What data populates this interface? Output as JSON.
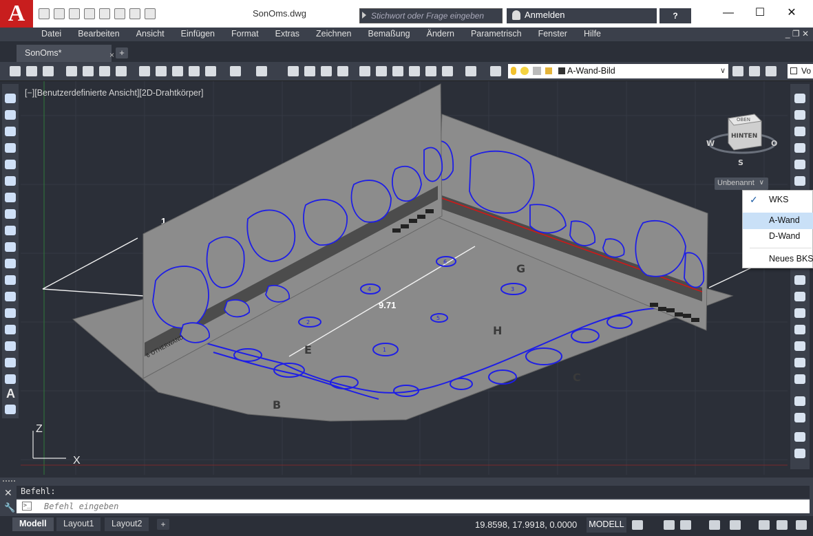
{
  "app": {
    "logo_text": "A",
    "document_title": "SonOms.dwg",
    "search_placeholder": "Stichwort oder Frage eingeben",
    "login_label": "Anmelden",
    "help_label": "?",
    "window_controls": [
      "minimize-icon",
      "maximize-icon",
      "close-icon"
    ],
    "accent_color": "#c81e1e"
  },
  "menu": [
    "Datei",
    "Bearbeiten",
    "Ansicht",
    "Einfügen",
    "Format",
    "Extras",
    "Zeichnen",
    "Bemaßung",
    "Ändern",
    "Parametrisch",
    "Fenster",
    "Hilfe"
  ],
  "tabs": {
    "file_tab": "SonOms*",
    "close_glyph": "×",
    "new_tab_glyph": "+"
  },
  "toolbar": {
    "layer_name": "A-Wand-Bild",
    "visual_style_fragment": "Vo"
  },
  "viewport": {
    "label": "[−][Benutzerdefinierte Ansicht][2D-Drahtkörper]",
    "dimension_text": "9.71",
    "dimension_left": "1",
    "area_letters": [
      "G",
      "H",
      "E",
      "B",
      "C"
    ],
    "stone_numbers": [
      "2",
      "4",
      "5",
      "6",
      "3",
      "1"
    ],
    "axis_z": "Z",
    "axis_x": "X",
    "plate_caption": "6 OTHERWAND"
  },
  "viewcube": {
    "face_label": "HINTEN",
    "top_label": "OBEN",
    "compass": {
      "west": "W",
      "east": "O",
      "south": "S"
    },
    "ucs_label": "Unbenannt"
  },
  "ucs_menu": {
    "items": [
      {
        "label": "WKS",
        "checked": true
      },
      {
        "label": "A-Wand",
        "selected": true
      },
      {
        "label": "D-Wand"
      },
      {
        "label": "Neues BKS"
      }
    ],
    "check_glyph": "✓"
  },
  "command": {
    "history": "Befehl:",
    "placeholder": "Befehl eingeben",
    "prompt_glyph": ">_"
  },
  "status": {
    "layout_tabs": [
      "Modell",
      "Layout1",
      "Layout2"
    ],
    "add_layout_glyph": "+",
    "coordinates": "19.8598, 17.9918, 0.0000",
    "space": "MODELL"
  },
  "colors": {
    "drawing_blue": "#1e1ee6",
    "panel_gray": "#8a8a8a",
    "canvas": "#2b2f38",
    "section_red": "#d01818"
  }
}
